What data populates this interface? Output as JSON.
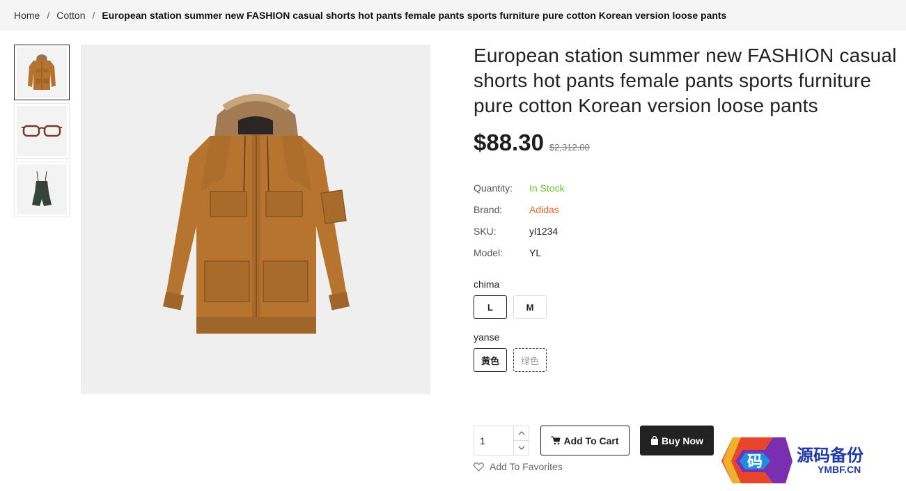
{
  "breadcrumb": {
    "home": "Home",
    "category": "Cotton",
    "current": "European station summer new FASHION casual shorts hot pants female pants sports furniture pure cotton Korean version loose pants"
  },
  "thumbnails": [
    {
      "icon": "jacket-image",
      "selected": true
    },
    {
      "icon": "glasses-image",
      "selected": false
    },
    {
      "icon": "romper-image",
      "selected": false
    }
  ],
  "product": {
    "title": "European station summer new FASHION casual shorts hot pants female pants sports furniture pure cotton Korean version loose pants",
    "price": "$88.30",
    "old_price": "$2,312.00",
    "specs": {
      "quantity_label": "Quantity:",
      "quantity_value": "In Stock",
      "brand_label": "Brand:",
      "brand_value": "Adidas",
      "sku_label": "SKU:",
      "sku_value": "yl1234",
      "model_label": "Model:",
      "model_value": "YL"
    },
    "options": {
      "size_label": "chima",
      "sizes": [
        "L",
        "M"
      ],
      "selected_size": "L",
      "color_label": "yanse",
      "colors": [
        "黄色",
        "绿色"
      ],
      "selected_color": "黄色"
    }
  },
  "cart": {
    "quantity": "1",
    "add_to_cart": "Add To Cart",
    "buy_now": "Buy Now",
    "favorites": "Add To Favorites"
  },
  "watermark": {
    "logo_char": "码",
    "text_cn": "源码备份",
    "text_en": "YMBF.CN"
  },
  "colors": {
    "in_stock": "#6cbf2f",
    "brand": "#e8652a",
    "dark": "#222222"
  }
}
